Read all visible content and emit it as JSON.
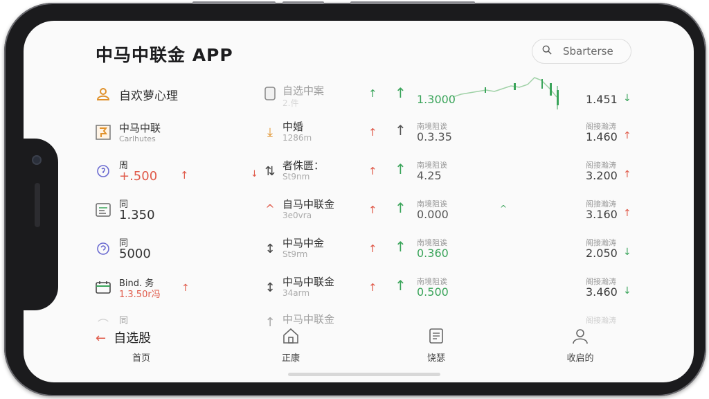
{
  "app": {
    "title": "中马中联金 APP"
  },
  "search": {
    "placeholder": "Sbarterse"
  },
  "rows": [
    {
      "c1": {
        "icon": "user-icon",
        "title": "自欢萝心理",
        "sub": ""
      },
      "c2": {
        "icon": "square-icon",
        "title": "自选中案",
        "sub": "2.件"
      },
      "small_arrow": "↑",
      "big_arrow": "↑",
      "c3": {
        "label": "",
        "value": "1.3000"
      },
      "c4": {
        "label": "",
        "value": "1.451",
        "arrow": "↓"
      }
    },
    {
      "c1": {
        "icon": "flag-icon",
        "title": "中马中联",
        "sub": "Carlhutes"
      },
      "c2": {
        "icon": "download-icon",
        "title": "中婚",
        "sub": "1286m"
      },
      "small_arrow": "↑",
      "big_arrow": "↑",
      "c3": {
        "label": "南境阻诶",
        "value": "0.3.35"
      },
      "c4": {
        "label": "阁接瀚涛",
        "value": "1.460",
        "arrow": "↑"
      }
    },
    {
      "c1": {
        "icon": "refresh-icon",
        "title": "周",
        "sub": "+.500"
      },
      "c2": {
        "icon": "transfer-icon",
        "title": "者侏匮：",
        "sub": "St9nm"
      },
      "small_arrow": "↑",
      "big_arrow": "↑",
      "c3": {
        "label": "南境阻诶",
        "value": "4.25"
      },
      "c4": {
        "label": "阁接瀚涛",
        "value": "3.200",
        "arrow": "↑"
      }
    },
    {
      "c1": {
        "icon": "chart-card-icon",
        "title": "同",
        "sub": "1.350"
      },
      "c2": {
        "icon": "caret-up-icon",
        "title": "自马中联金",
        "sub": "3e0vra"
      },
      "small_arrow": "↑",
      "big_arrow": "↑",
      "c3": {
        "label": "南境阻诶",
        "value": "0.000"
      },
      "c4": {
        "label": "阁接瀚涛",
        "value": "3.160",
        "arrow": "↑"
      }
    },
    {
      "c1": {
        "icon": "support-icon",
        "title": "同",
        "sub": "5000"
      },
      "c2": {
        "icon": "updown-arrow-icon",
        "title": "中马中金",
        "sub": "St9rm"
      },
      "small_arrow": "↑",
      "big_arrow": "↑",
      "c3": {
        "label": "南境阻诶",
        "value": "0.360"
      },
      "c4": {
        "label": "阁接瀚涛",
        "value": "2.050",
        "arrow": "↓"
      }
    },
    {
      "c1": {
        "icon": "wallet-icon",
        "title": "Bind. 务",
        "sub": "1.3.50r冯"
      },
      "c2": {
        "icon": "updown-arrow-icon",
        "title": "中马中联金",
        "sub": "34arm"
      },
      "small_arrow": "↑",
      "big_arrow": "↑",
      "c3": {
        "label": "南境阻诶",
        "value": "0.500"
      },
      "c4": {
        "label": "阁接瀚涛",
        "value": "3.460",
        "arrow": "↓"
      }
    },
    {
      "c1": {
        "icon": "misc-icon",
        "title": "同",
        "sub": ""
      },
      "c2": {
        "icon": "up-arrow-icon",
        "title": "中马中联金",
        "sub": ""
      },
      "small_arrow": "",
      "big_arrow": "",
      "c3": {
        "label": "",
        "value": ""
      },
      "c4": {
        "label": "阁接瀚涛",
        "value": "",
        "arrow": ""
      }
    }
  ],
  "tabs": {
    "back_label": "自选股",
    "home": "首页",
    "market": "正康",
    "news": "饶瑟",
    "profile": "收启的"
  },
  "colors": {
    "up": "#e05a4a",
    "down": "#3aa45a",
    "accent": "#e0912b"
  }
}
